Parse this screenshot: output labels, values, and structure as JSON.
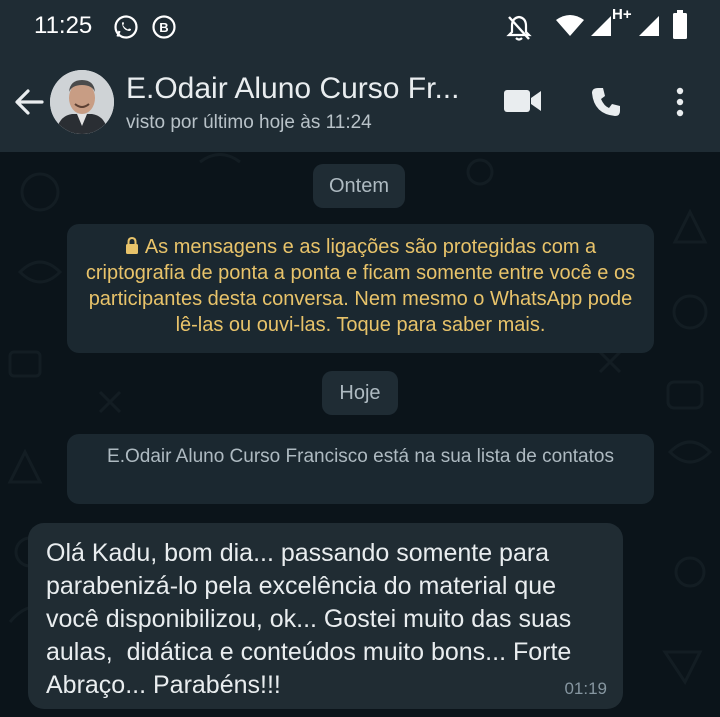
{
  "status_bar": {
    "time": "11:25",
    "network_label": "H+",
    "icons": [
      "whatsapp-icon",
      "b-badge-icon",
      "notifications-off-icon",
      "wifi-icon",
      "signal-icon",
      "signal-icon",
      "battery-icon"
    ]
  },
  "header": {
    "contact_name": "E.Odair Aluno Curso Fr...",
    "last_seen": "visto por último hoje às 11:24",
    "icons": [
      "back-arrow-icon",
      "video-call-icon",
      "phone-icon",
      "more-vert-icon"
    ]
  },
  "chat": {
    "date_chip_1": "Ontem",
    "encryption_notice": "As mensagens e as ligações são protegidas com a criptografia de ponta a ponta e ficam somente entre você e os participantes desta conversa. Nem mesmo o WhatsApp pode lê-las ou ouvi-las. Toque para saber mais.",
    "date_chip_2": "Hoje",
    "contact_notice": "E.Odair Aluno Curso Francisco está na sua lista de contatos",
    "message": {
      "text": "Olá Kadu, bom dia... passando somente para parabenizá-lo pela excelência do material que você disponibilizou, ok... Gostei muito das suas aulas,  didática e conteúdos muito bons... Forte Abraço... Parabéns!!!",
      "time": "01:19"
    }
  },
  "colors": {
    "header_bg": "#1f2c34",
    "chat_bg": "#0b141a",
    "bubble_bg": "#202c33",
    "notice_text": "#e8c36a"
  }
}
